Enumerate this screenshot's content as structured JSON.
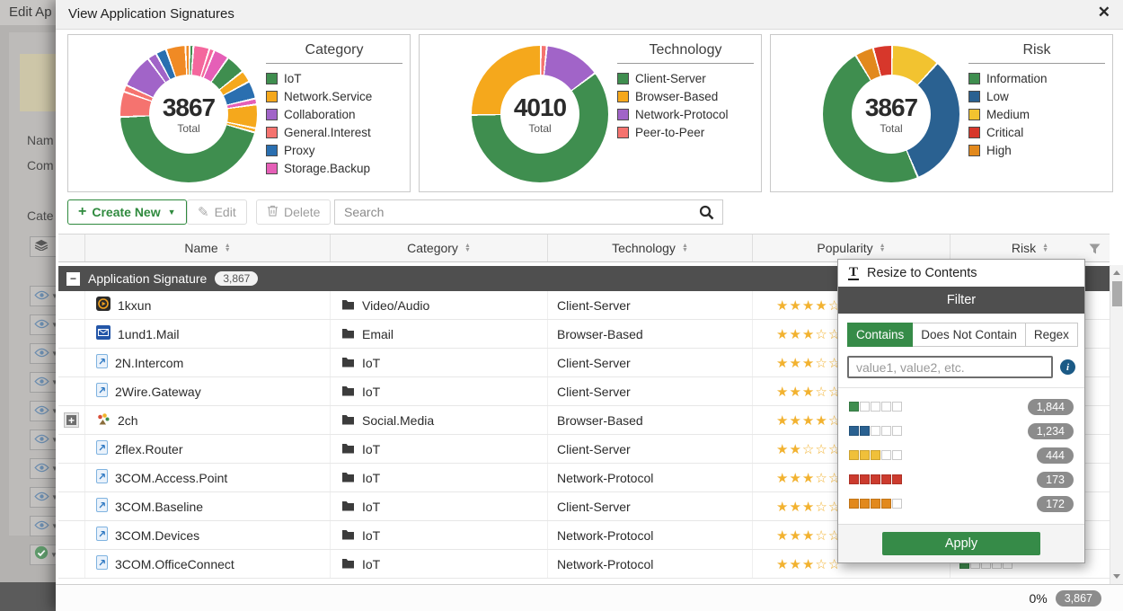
{
  "modal": {
    "title": "View Application Signatures",
    "close_icon": "✕"
  },
  "charts": [
    {
      "type": "donut",
      "name": "Category",
      "total": "3867",
      "total_label": "Total",
      "legend": [
        {
          "label": "IoT",
          "color": "#3f8e4f"
        },
        {
          "label": "Network.Service",
          "color": "#f5a81c"
        },
        {
          "label": "Collaboration",
          "color": "#a164c8"
        },
        {
          "label": "General.Interest",
          "color": "#f5736f"
        },
        {
          "label": "Proxy",
          "color": "#2a6fb0"
        },
        {
          "label": "Storage.Backup",
          "color": "#e55fb7"
        }
      ],
      "segments": [
        {
          "color": "#3f8e4f",
          "pct": 0.9
        },
        {
          "color": "#f4679d",
          "pct": 3.8
        },
        {
          "color": "#f4679d",
          "pct": 1.2
        },
        {
          "color": "#e55fb7",
          "pct": 3.6
        },
        {
          "color": "#3f8e4f",
          "pct": 4.6
        },
        {
          "color": "#f5a81c",
          "pct": 2.8
        },
        {
          "color": "#2a6fb0",
          "pct": 4.2
        },
        {
          "color": "#e55fb7",
          "pct": 1.4
        },
        {
          "color": "#f5a81c",
          "pct": 5.6
        },
        {
          "color": "#f5a81c",
          "pct": 1.0
        },
        {
          "color": "#3f8e4f",
          "pct": 45.0
        },
        {
          "color": "#f5736f",
          "pct": 6.0
        },
        {
          "color": "#f5736f",
          "pct": 1.6
        },
        {
          "color": "#a164c8",
          "pct": 8.0
        },
        {
          "color": "#a164c8",
          "pct": 2.2
        },
        {
          "color": "#2a6fb0",
          "pct": 2.5
        },
        {
          "color": "#f08a24",
          "pct": 4.6
        },
        {
          "color": "#f08a24",
          "pct": 1.0
        }
      ]
    },
    {
      "type": "donut",
      "name": "Technology",
      "total": "4010",
      "total_label": "Total",
      "legend": [
        {
          "label": "Client-Server",
          "color": "#3f8e4f"
        },
        {
          "label": "Browser-Based",
          "color": "#f5a81c"
        },
        {
          "label": "Network-Protocol",
          "color": "#a164c8"
        },
        {
          "label": "Peer-to-Peer",
          "color": "#f5736f"
        }
      ],
      "segments": [
        {
          "color": "#f5736f",
          "pct": 1.4
        },
        {
          "color": "#a164c8",
          "pct": 13.2
        },
        {
          "color": "#3f8e4f",
          "pct": 60.0
        },
        {
          "color": "#f5a81c",
          "pct": 25.4
        }
      ]
    },
    {
      "type": "donut",
      "name": "Risk",
      "total": "3867",
      "total_label": "Total",
      "legend": [
        {
          "label": "Information",
          "color": "#3f8e4f",
          "value": 1844
        },
        {
          "label": "Low",
          "color": "#2a6191",
          "value": 1234
        },
        {
          "label": "Medium",
          "color": "#f2c330",
          "value": 444
        },
        {
          "label": "Critical",
          "color": "#d7372b",
          "value": 173
        },
        {
          "label": "High",
          "color": "#e2891d",
          "value": 172
        }
      ],
      "segments": [
        {
          "color": "#f2c330",
          "pct": 11.5
        },
        {
          "color": "#2a6191",
          "pct": 31.9
        },
        {
          "color": "#3f8e4f",
          "pct": 47.7
        },
        {
          "color": "#e2891d",
          "pct": 4.4
        },
        {
          "color": "#d7372b",
          "pct": 4.5
        }
      ]
    }
  ],
  "toolbar": {
    "create_new_label": "Create New",
    "edit_label": "Edit",
    "delete_label": "Delete",
    "search_placeholder": "Search"
  },
  "table": {
    "headers": [
      "Name",
      "Category",
      "Technology",
      "Popularity",
      "Risk"
    ],
    "group": {
      "label": "Application Signature",
      "count": "3,867"
    },
    "rows": [
      {
        "icon": "app-1kxun",
        "name": "1kxun",
        "category": "Video/Audio",
        "technology": "Client-Server",
        "popularity": 4,
        "risk_filled": null,
        "expandable": false
      },
      {
        "icon": "mail",
        "name": "1und1.Mail",
        "category": "Email",
        "technology": "Browser-Based",
        "popularity": 3,
        "risk_filled": null,
        "expandable": false
      },
      {
        "icon": "doc",
        "name": "2N.Intercom",
        "category": "IoT",
        "technology": "Client-Server",
        "popularity": 3,
        "risk_filled": null,
        "expandable": false
      },
      {
        "icon": "doc",
        "name": "2Wire.Gateway",
        "category": "IoT",
        "technology": "Client-Server",
        "popularity": 3,
        "risk_filled": null,
        "expandable": false
      },
      {
        "icon": "app-2ch",
        "name": "2ch",
        "category": "Social.Media",
        "technology": "Browser-Based",
        "popularity": 4,
        "risk_filled": null,
        "expandable": true
      },
      {
        "icon": "doc",
        "name": "2flex.Router",
        "category": "IoT",
        "technology": "Client-Server",
        "popularity": 2,
        "risk_filled": null,
        "expandable": false
      },
      {
        "icon": "doc",
        "name": "3COM.Access.Point",
        "category": "IoT",
        "technology": "Network-Protocol",
        "popularity": 3,
        "risk_filled": null,
        "expandable": false
      },
      {
        "icon": "doc",
        "name": "3COM.Baseline",
        "category": "IoT",
        "technology": "Client-Server",
        "popularity": 3,
        "risk_filled": null,
        "expandable": false
      },
      {
        "icon": "doc",
        "name": "3COM.Devices",
        "category": "IoT",
        "technology": "Network-Protocol",
        "popularity": 3,
        "risk_filled": null,
        "expandable": false
      },
      {
        "icon": "doc",
        "name": "3COM.OfficeConnect",
        "category": "IoT",
        "technology": "Network-Protocol",
        "popularity": 3,
        "risk_filled": 1,
        "risk_color": "#3f8e4f",
        "expandable": false
      }
    ]
  },
  "filter_popup": {
    "resize_label": "Resize to Contents",
    "filter_title": "Filter",
    "tabs": [
      {
        "label": "Contains",
        "selected": true
      },
      {
        "label": "Does Not Contain",
        "selected": false
      },
      {
        "label": "Regex",
        "selected": false
      }
    ],
    "input_placeholder": "value1, value2, etc.",
    "options": [
      {
        "filled": 1,
        "color": "#3f8e4f",
        "count": "1,844"
      },
      {
        "filled": 2,
        "color": "#2a6191",
        "count": "1,234"
      },
      {
        "filled": 3,
        "color": "#f0c03a",
        "count": "444"
      },
      {
        "filled": 5,
        "color": "#cc3b2e",
        "count": "173"
      },
      {
        "filled": 4,
        "color": "#e2891d",
        "count": "172"
      }
    ],
    "apply_label": "Apply"
  },
  "footer": {
    "percent": "0%",
    "count": "3,867"
  },
  "background_page": {
    "title": "Edit Ap",
    "field_labels": [
      "Nam",
      "Com",
      "Cate"
    ],
    "eye_button_count": 9
  },
  "colors": {
    "accent_green": "#368b48",
    "dark_bar": "#4f4f4f",
    "star_gold": "#f2b230",
    "badge_gray": "#8c8c8c"
  }
}
